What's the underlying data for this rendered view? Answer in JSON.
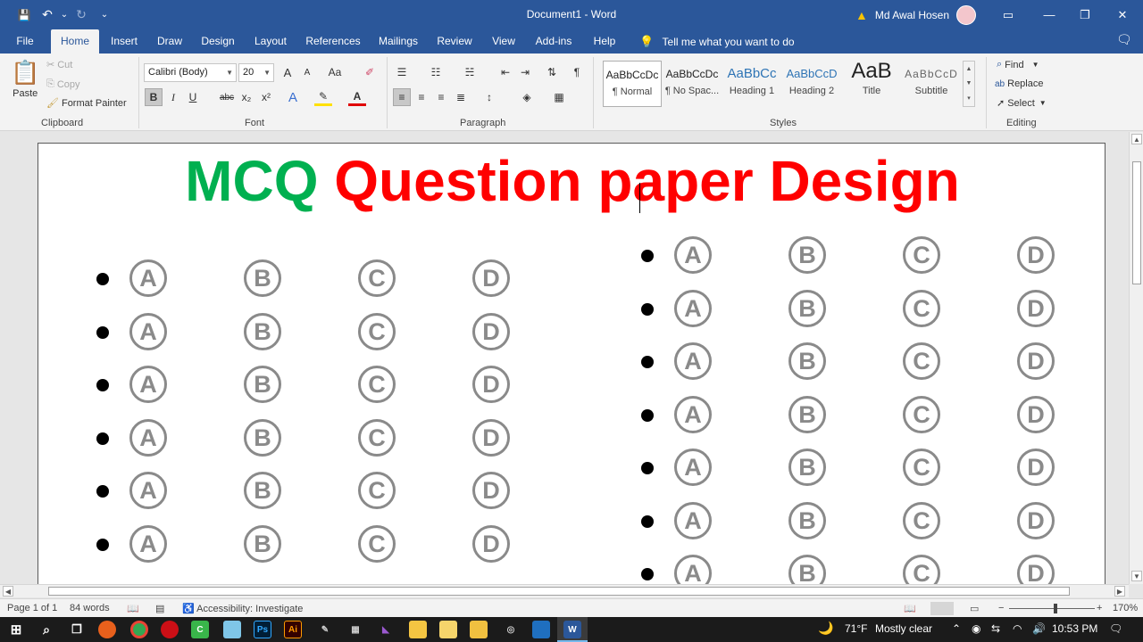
{
  "titlebar": {
    "doc_title": "Document1  -  Word",
    "user_name": "Md Awal Hosen",
    "quick_access": {
      "save": "💾",
      "undo": "↶",
      "undo_dd": "⌄",
      "redo": "↻",
      "customize": "⌄"
    },
    "window_buttons": {
      "ribbon_options": "▭",
      "minimize": "—",
      "restore": "❐",
      "close": "✕"
    }
  },
  "tabs": [
    "File",
    "Home",
    "Insert",
    "Draw",
    "Design",
    "Layout",
    "References",
    "Mailings",
    "Review",
    "View",
    "Add-ins",
    "Help"
  ],
  "active_tab": "Home",
  "tell_me": "Tell me what you want to do",
  "ribbon": {
    "clipboard": {
      "paste": "Paste",
      "cut": "Cut",
      "copy": "Copy",
      "format_painter": "Format Painter",
      "label": "Clipboard"
    },
    "font": {
      "font_name": "Calibri (Body)",
      "font_size": "20",
      "grow": "A",
      "shrink": "A",
      "case": "Aa",
      "bold": "B",
      "italic": "I",
      "underline": "U",
      "strike": "abc",
      "subscript": "x₂",
      "superscript": "x²",
      "effects": "A",
      "highlight": "✎",
      "color": "A",
      "label": "Font"
    },
    "paragraph": {
      "label": "Paragraph"
    },
    "styles": {
      "items": [
        {
          "preview": "AaBbCcDc",
          "name": "¶ Normal"
        },
        {
          "preview": "AaBbCcDc",
          "name": "¶ No Spac..."
        },
        {
          "preview": "AaBbCc",
          "name": "Heading 1"
        },
        {
          "preview": "AaBbCcD",
          "name": "Heading 2"
        },
        {
          "preview": "AaB",
          "name": "Title"
        },
        {
          "preview": "AaBbCcD",
          "name": "Subtitle"
        }
      ],
      "label": "Styles"
    },
    "editing": {
      "find": "Find",
      "replace": "Replace",
      "select": "Select",
      "label": "Editing"
    }
  },
  "document": {
    "title_green": "MCQ",
    "title_red": "Question paper Design",
    "options": [
      "A",
      "B",
      "C",
      "D"
    ],
    "left_column_rows": 6,
    "right_column_rows": 7
  },
  "statusbar": {
    "page": "Page 1 of 1",
    "words": "84 words",
    "accessibility": "Accessibility: Investigate",
    "zoom": "170%",
    "zoom_minus": "−",
    "zoom_plus": "+"
  },
  "taskbar": {
    "weather_temp": "71°F",
    "weather_desc": "Mostly clear",
    "time": "10:53 PM"
  },
  "colors": {
    "ribbon_blue": "#2b579a",
    "title_green": "#00b050",
    "title_red": "#ff0000",
    "option_gray": "#8a8a8a"
  }
}
